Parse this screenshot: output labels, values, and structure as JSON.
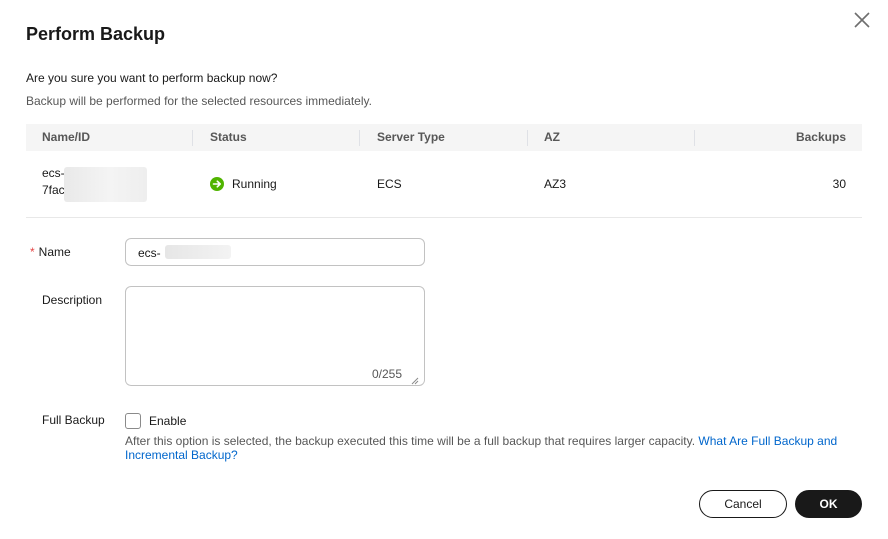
{
  "dialog": {
    "title": "Perform Backup",
    "confirm_text": "Are you sure you want to perform backup now?",
    "sub_text": "Backup will be performed for the selected resources immediately."
  },
  "table": {
    "headers": {
      "name": "Name/ID",
      "status": "Status",
      "server_type": "Server Type",
      "az": "AZ",
      "backups": "Backups"
    },
    "rows": [
      {
        "name_line1": "ecs-",
        "name_line2": "7fac",
        "status": "Running",
        "server_type": "ECS",
        "az": "AZ3",
        "backups": "30"
      }
    ]
  },
  "form": {
    "name_label": "Name",
    "required_mark": "*",
    "name_value": "ecs-",
    "description_label": "Description",
    "description_counter": "0/255",
    "full_backup_label": "Full Backup",
    "enable_label": "Enable",
    "help_text": "After this option is selected, the backup executed this time will be a full backup that requires larger capacity.",
    "help_link": "What Are Full Backup and Incremental Backup?"
  },
  "actions": {
    "cancel": "Cancel",
    "ok": "OK"
  },
  "colors": {
    "status_running": "#50b400",
    "link": "#0066cc",
    "primary_button": "#191919",
    "required": "#e54545"
  },
  "icons": {
    "close": "close-icon",
    "status": "running-status-icon",
    "resize": "resize-handle-icon"
  }
}
